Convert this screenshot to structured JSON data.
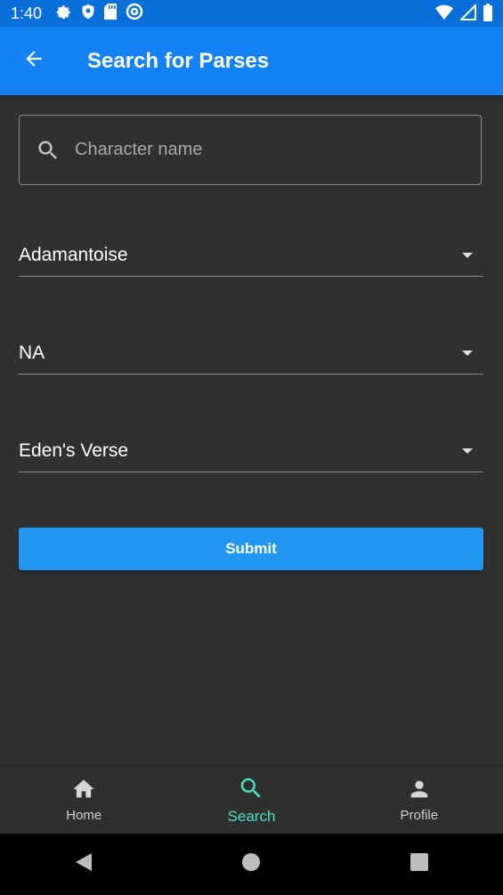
{
  "status_bar": {
    "time": "1:40",
    "left_icons": [
      "gear-icon",
      "shield-icon",
      "sd-card-icon",
      "at-sign-icon"
    ],
    "right_icons": [
      "wifi-icon",
      "cell-signal-icon",
      "battery-icon"
    ]
  },
  "app_bar": {
    "title": "Search for Parses",
    "back_icon": "arrow-left-icon",
    "color": "#1482f5"
  },
  "search": {
    "placeholder": "Character name",
    "value": "",
    "icon": "search-icon"
  },
  "dropdowns": [
    {
      "name": "server",
      "value": "Adamantoise"
    },
    {
      "name": "region",
      "value": "NA"
    },
    {
      "name": "zone",
      "value": "Eden's Verse"
    }
  ],
  "submit": {
    "label": "Submit",
    "color": "#2196f3"
  },
  "bottom_nav": {
    "items": [
      {
        "label": "Home",
        "icon": "home-icon",
        "active": false
      },
      {
        "label": "Search",
        "icon": "search-icon",
        "active": true
      },
      {
        "label": "Profile",
        "icon": "person-icon",
        "active": false
      }
    ],
    "active_color": "#4de0c0"
  },
  "system_nav": [
    "back-triangle-icon",
    "home-circle-icon",
    "recents-square-icon"
  ]
}
